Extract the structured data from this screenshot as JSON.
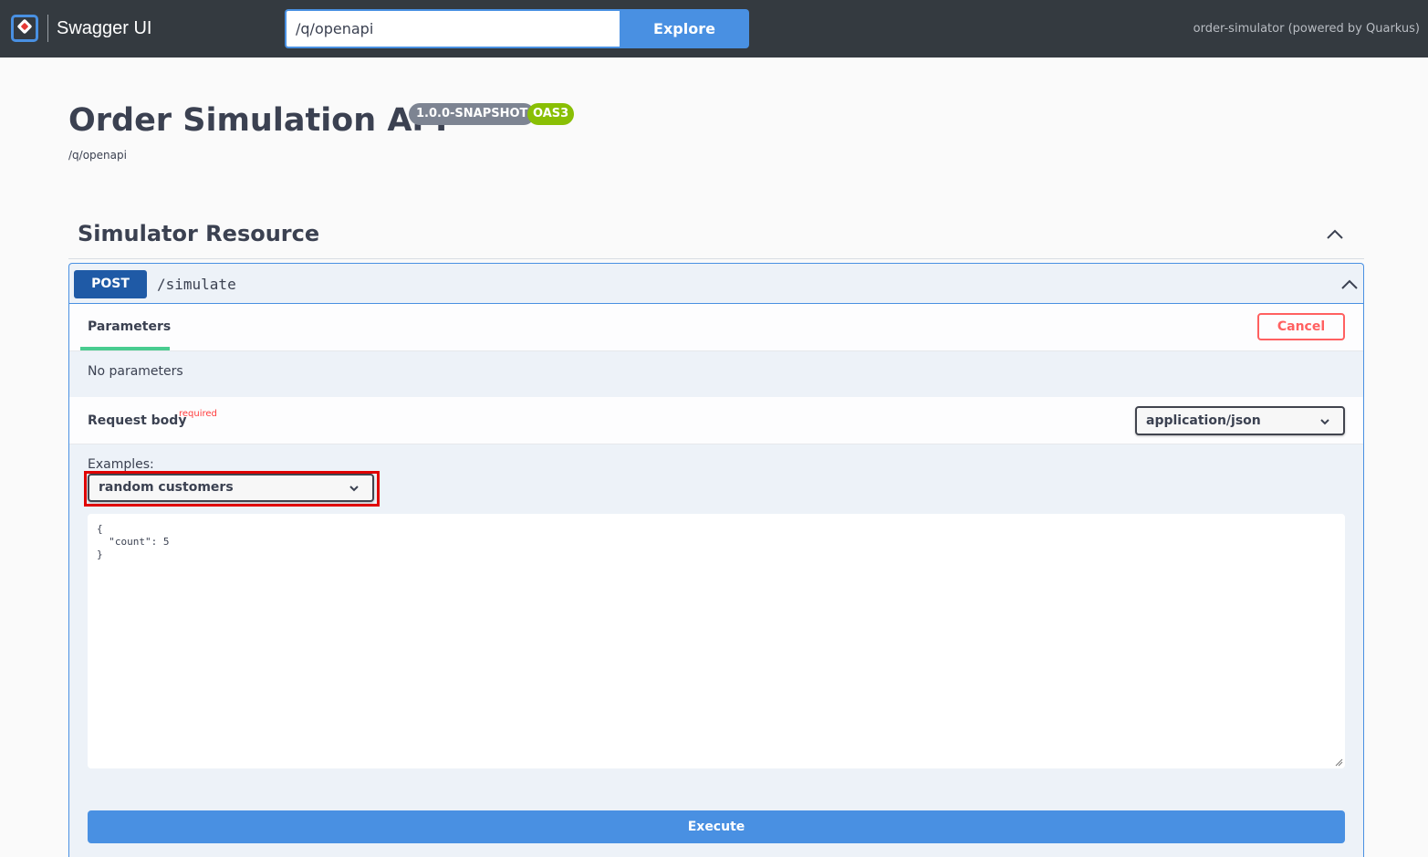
{
  "topbar": {
    "brand": "Swagger UI",
    "url_value": "/q/openapi",
    "explore_label": "Explore",
    "powered_by": "order-simulator (powered by Quarkus)"
  },
  "info": {
    "title": "Order Simulation API",
    "version": "1.0.0-SNAPSHOT",
    "oas_badge": "OAS3",
    "spec_url": "/q/openapi"
  },
  "tag": {
    "name": "Simulator Resource"
  },
  "operation": {
    "method": "POST",
    "path": "/simulate",
    "parameters_tab": "Parameters",
    "cancel_label": "Cancel",
    "no_parameters": "No parameters",
    "request_body_label": "Request body",
    "required_label": "required",
    "content_type": "application/json",
    "examples_label": "Examples:",
    "example_selected": "random customers",
    "body_text": "{\n  \"count\": 5\n}",
    "execute_label": "Execute"
  },
  "colors": {
    "topbar": "#343a40",
    "accent_blue": "#4990e2",
    "post_method": "#1f5aa6",
    "oas_green": "#89bf04",
    "cancel_red": "#ff6060",
    "tab_green": "#49cc90",
    "highlight_red": "#e00000"
  },
  "icons": [
    "swagger-logo-icon",
    "chevron-up-icon",
    "chevron-down-icon",
    "resize-handle-icon"
  ]
}
